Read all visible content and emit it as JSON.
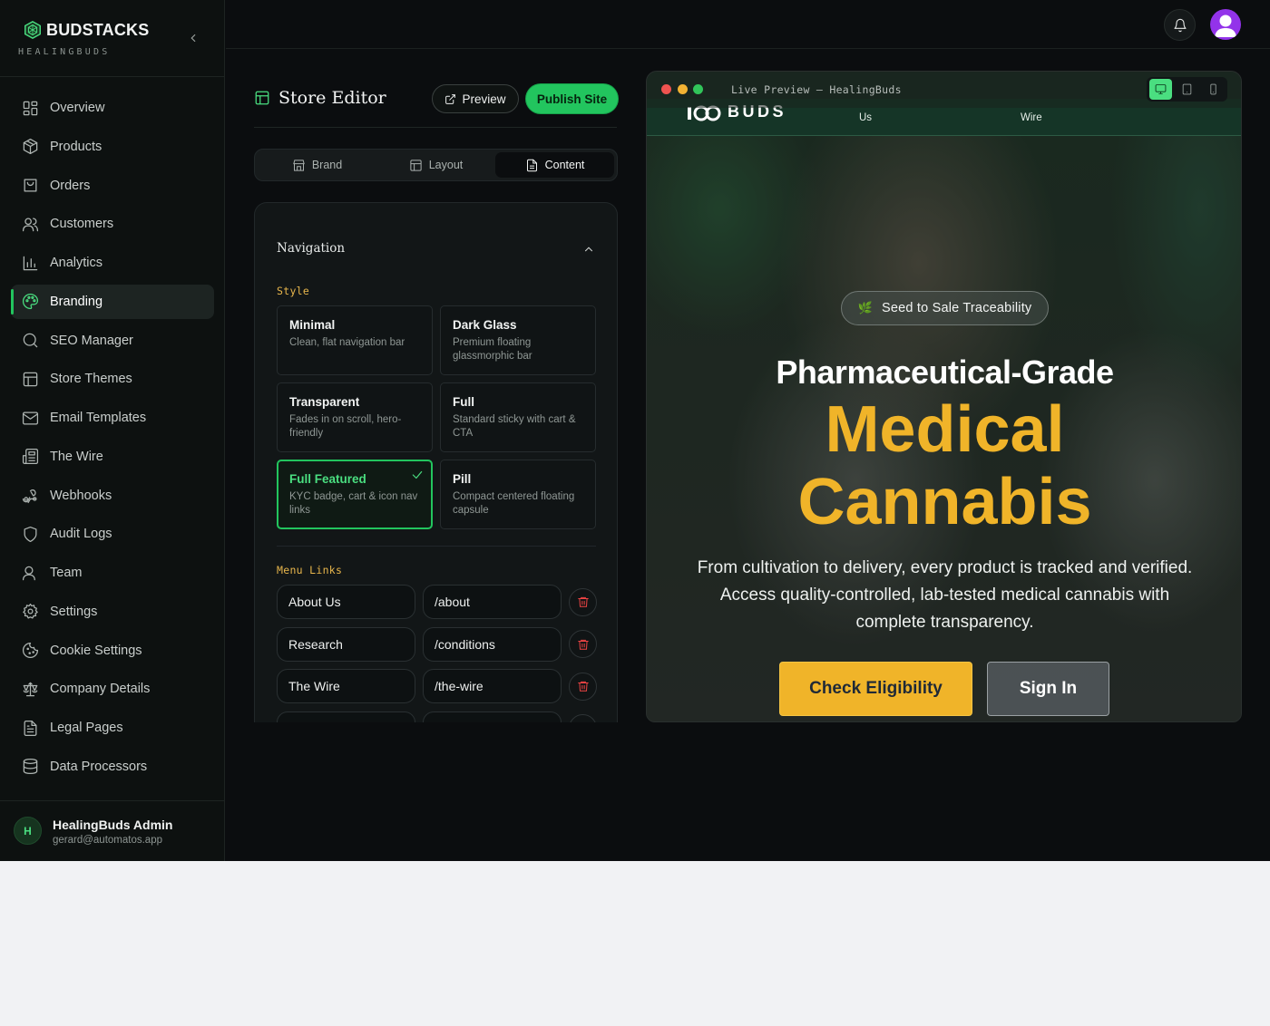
{
  "sidebar": {
    "brand_name": "BUDSTACKS",
    "brand_sub": "HEALINGBUDS",
    "items": [
      {
        "label": "Overview",
        "icon": "grid-icon"
      },
      {
        "label": "Products",
        "icon": "package-icon"
      },
      {
        "label": "Orders",
        "icon": "shopping-bag-icon"
      },
      {
        "label": "Customers",
        "icon": "users-icon"
      },
      {
        "label": "Analytics",
        "icon": "bar-chart-icon"
      },
      {
        "label": "Branding",
        "icon": "palette-icon",
        "active": true
      },
      {
        "label": "SEO Manager",
        "icon": "search-icon"
      },
      {
        "label": "Store Themes",
        "icon": "layout-icon"
      },
      {
        "label": "Email Templates",
        "icon": "mail-icon"
      },
      {
        "label": "The Wire",
        "icon": "newspaper-icon"
      },
      {
        "label": "Webhooks",
        "icon": "webhook-icon"
      },
      {
        "label": "Audit Logs",
        "icon": "shield-icon"
      },
      {
        "label": "Team",
        "icon": "user-icon"
      },
      {
        "label": "Settings",
        "icon": "gear-icon"
      },
      {
        "label": "Cookie Settings",
        "icon": "cookie-icon"
      },
      {
        "label": "Company Details",
        "icon": "scale-icon"
      },
      {
        "label": "Legal Pages",
        "icon": "file-text-icon"
      },
      {
        "label": "Data Processors",
        "icon": "database-icon"
      }
    ],
    "user": {
      "initial": "H",
      "name": "HealingBuds Admin",
      "email": "gerard@automatos.app"
    }
  },
  "editor": {
    "title": "Store Editor",
    "preview_label": "Preview",
    "publish_label": "Publish Site",
    "tabs": [
      {
        "label": "Brand",
        "icon": "store-icon"
      },
      {
        "label": "Layout",
        "icon": "layout-icon"
      },
      {
        "label": "Content",
        "icon": "file-icon",
        "active": true
      }
    ],
    "section_title": "Navigation",
    "style_label": "Style",
    "styles": [
      {
        "title": "Minimal",
        "desc": "Clean, flat navigation bar"
      },
      {
        "title": "Dark Glass",
        "desc": "Premium floating glassmorphic bar"
      },
      {
        "title": "Transparent",
        "desc": "Fades in on scroll, hero-friendly"
      },
      {
        "title": "Full",
        "desc": "Standard sticky with cart & CTA"
      },
      {
        "title": "Full Featured",
        "desc": "KYC badge, cart & icon nav links",
        "selected": true
      },
      {
        "title": "Pill",
        "desc": "Compact centered floating capsule"
      }
    ],
    "menu_label": "Menu Links",
    "links": [
      {
        "label": "About Us",
        "path": "/about"
      },
      {
        "label": "Research",
        "path": "/conditions"
      },
      {
        "label": "The Wire",
        "path": "/the-wire"
      },
      {
        "label": "",
        "path": ""
      }
    ]
  },
  "preview": {
    "window_title": "Live Preview — HealingBuds",
    "nav_logo": "BUDS",
    "nav_items": [
      "Us",
      "Wire"
    ],
    "badge": "Seed to Sale Traceability",
    "headline_1": "Pharmaceutical-Grade",
    "headline_2": "Medical",
    "headline_3": "Cannabis",
    "description": "From cultivation to delivery, every product is tracked and verified. Access quality-controlled, lab-tested medical cannabis with complete transparency.",
    "cta_primary": "Check Eligibility",
    "cta_secondary": "Sign In",
    "device_modes": [
      "desktop-icon",
      "tablet-icon",
      "phone-icon"
    ]
  },
  "colors": {
    "accent": "#22c55e",
    "gold": "#f0b429",
    "danger": "#ef4444"
  }
}
